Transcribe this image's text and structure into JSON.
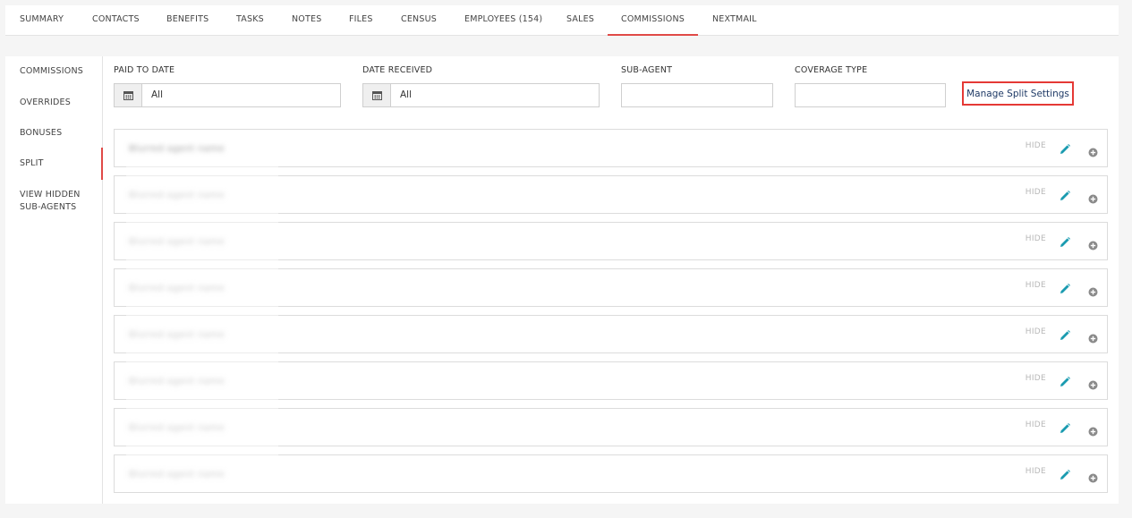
{
  "tabs": [
    {
      "label": "SUMMARY"
    },
    {
      "label": "CONTACTS"
    },
    {
      "label": "BENEFITS"
    },
    {
      "label": "TASKS"
    },
    {
      "label": "NOTES"
    },
    {
      "label": "FILES"
    },
    {
      "label": "CENSUS"
    },
    {
      "label": "EMPLOYEES (154)"
    },
    {
      "label": "SALES"
    },
    {
      "label": "COMMISSIONS",
      "active": true
    },
    {
      "label": "NEXTMAIL"
    }
  ],
  "sidebar": {
    "items": [
      {
        "label": "COMMISSIONS"
      },
      {
        "label": "OVERRIDES"
      },
      {
        "label": "BONUSES"
      },
      {
        "label": "SPLIT",
        "active": true
      },
      {
        "label": "VIEW HIDDEN SUB-AGENTS"
      }
    ]
  },
  "filters": {
    "paid_to_date": {
      "label": "PAID TO DATE",
      "value": "All"
    },
    "date_received": {
      "label": "DATE RECEIVED",
      "value": "All"
    },
    "sub_agent": {
      "label": "SUB-AGENT",
      "value": ""
    },
    "coverage_type": {
      "label": "COVERAGE TYPE",
      "value": ""
    }
  },
  "manage_split_settings_label": "Manage Split Settings",
  "agents": [
    {
      "name": "Blurred agent name",
      "hide_label": "HIDE"
    },
    {
      "name": "Blurred agent name",
      "hide_label": "HIDE"
    },
    {
      "name": "Blurred agent name",
      "hide_label": "HIDE"
    },
    {
      "name": "Blurred agent name",
      "hide_label": "HIDE"
    },
    {
      "name": "Blurred agent name",
      "hide_label": "HIDE"
    },
    {
      "name": "Blurred agent name",
      "hide_label": "HIDE"
    },
    {
      "name": "Blurred agent name",
      "hide_label": "HIDE"
    },
    {
      "name": "Blurred agent name",
      "hide_label": "HIDE"
    }
  ],
  "colors": {
    "accent": "#e04a47",
    "link": "#1f3a66",
    "edit_icon": "#1a9bb0",
    "add_icon": "#8a8a8a"
  }
}
